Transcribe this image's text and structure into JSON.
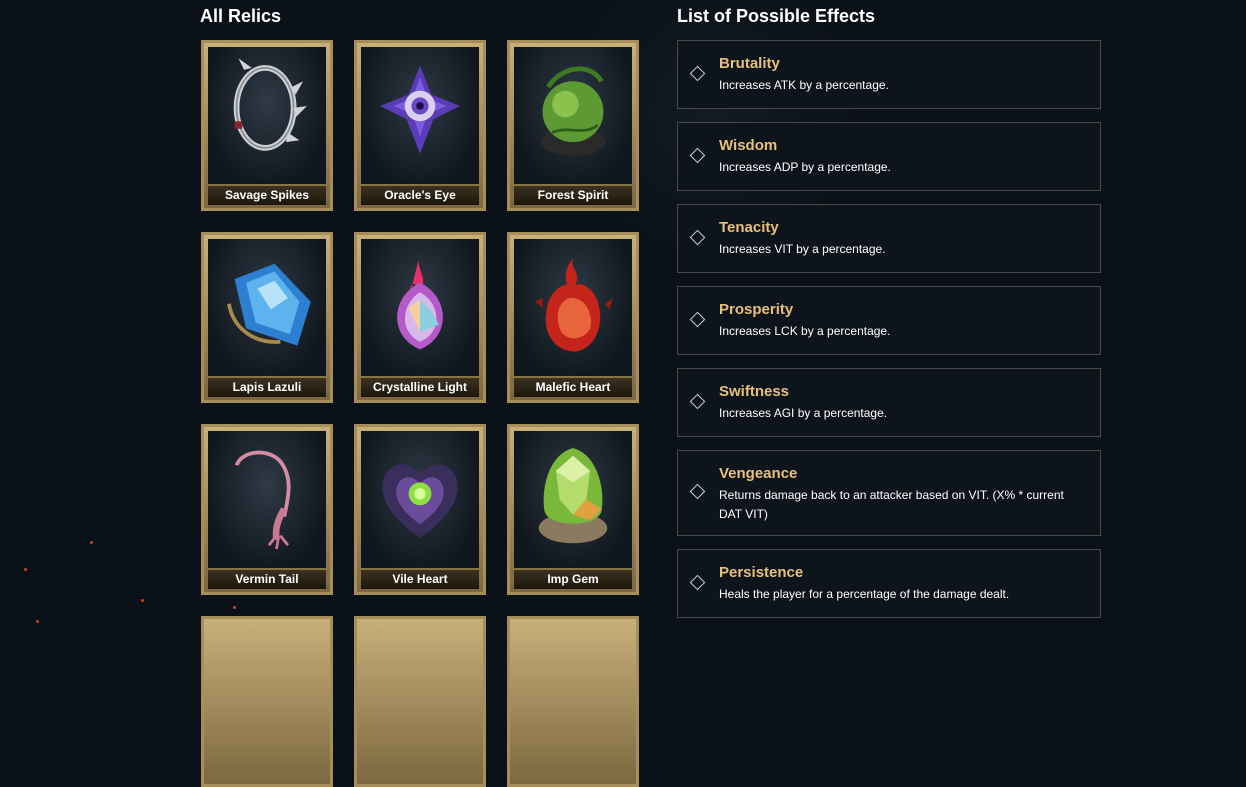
{
  "relics_section": {
    "title": "All Relics",
    "items": [
      {
        "name": "Savage Spikes",
        "icon": "spiked-ring-icon"
      },
      {
        "name": "Oracle's Eye",
        "icon": "eye-star-icon"
      },
      {
        "name": "Forest Spirit",
        "icon": "leaf-orb-icon"
      },
      {
        "name": "Lapis Lazuli",
        "icon": "blue-gem-icon"
      },
      {
        "name": "Crystalline Light",
        "icon": "prism-flame-icon"
      },
      {
        "name": "Malefic Heart",
        "icon": "red-heart-icon"
      },
      {
        "name": "Vermin Tail",
        "icon": "tail-icon"
      },
      {
        "name": "Vile Heart",
        "icon": "dark-heart-icon"
      },
      {
        "name": "Imp Gem",
        "icon": "green-egg-gem-icon"
      }
    ]
  },
  "effects_section": {
    "title": "List of Possible Effects",
    "items": [
      {
        "name": "Brutality",
        "description": "Increases ATK by a percentage."
      },
      {
        "name": "Wisdom",
        "description": "Increases ADP by a percentage."
      },
      {
        "name": "Tenacity",
        "description": "Increases VIT by a percentage."
      },
      {
        "name": "Prosperity",
        "description": "Increases LCK by a percentage."
      },
      {
        "name": "Swiftness",
        "description": "Increases AGI by a percentage."
      },
      {
        "name": "Vengeance",
        "description": "Returns damage back to an attacker based on VIT. (X% * current DAT VIT)"
      },
      {
        "name": "Persistence",
        "description": "Heals the player for a percentage of the damage dealt."
      }
    ]
  },
  "colors": {
    "background": "#0b1118",
    "effect_name": "#e8c07a",
    "card_frame": "#a88d5c"
  }
}
